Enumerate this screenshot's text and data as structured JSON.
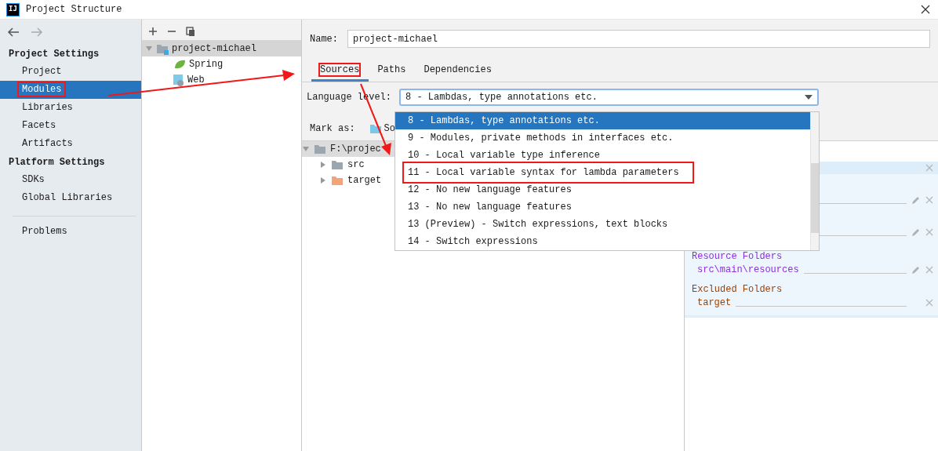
{
  "window": {
    "title": "Project Structure",
    "logo": "IJ"
  },
  "nav": {
    "sections": [
      {
        "heading": "Project Settings",
        "items": [
          {
            "label": "Project",
            "selected": false,
            "highlighted": false
          },
          {
            "label": "Modules",
            "selected": true,
            "highlighted": true
          },
          {
            "label": "Libraries",
            "selected": false,
            "highlighted": false
          },
          {
            "label": "Facets",
            "selected": false,
            "highlighted": false
          },
          {
            "label": "Artifacts",
            "selected": false,
            "highlighted": false
          }
        ]
      },
      {
        "heading": "Platform Settings",
        "items": [
          {
            "label": "SDKs",
            "selected": false,
            "highlighted": false
          },
          {
            "label": "Global Libraries",
            "selected": false,
            "highlighted": false
          }
        ]
      }
    ],
    "extra_items": [
      {
        "label": "Problems",
        "selected": false,
        "highlighted": false
      }
    ]
  },
  "module_tree": {
    "items": [
      {
        "label": "project-michael",
        "kind": "module",
        "selected": true,
        "expanded": true,
        "children": [
          {
            "label": "Spring",
            "kind": "spring",
            "selected": false
          },
          {
            "label": "Web",
            "kind": "web",
            "selected": false
          }
        ]
      }
    ]
  },
  "editor": {
    "name_label": "Name:",
    "name_value": "project-michael",
    "tabs": [
      {
        "label": "Sources",
        "selected": true,
        "highlighted": true
      },
      {
        "label": "Paths",
        "selected": false,
        "highlighted": false
      },
      {
        "label": "Dependencies",
        "selected": false,
        "highlighted": false
      }
    ],
    "language_level": {
      "label": "Language level:",
      "value": "8 - Lambdas, type annotations etc."
    },
    "mark_as": {
      "label": "Mark as:",
      "buttons": [
        "So"
      ]
    },
    "content_tree": [
      {
        "label": "F:\\projec",
        "kind": "root",
        "expanded": true,
        "children": [
          {
            "label": "src",
            "kind": "plain",
            "expanded": false
          },
          {
            "label": "target",
            "kind": "excluded",
            "expanded": false
          }
        ]
      }
    ],
    "roots_panel": {
      "groups": [
        {
          "heading": "Resource Folders",
          "kind": "resource",
          "paths": [
            {
              "path": "src\\main\\resources",
              "editable": true
            }
          ]
        },
        {
          "heading": "Excluded Folders",
          "kind": "excluded",
          "paths": [
            {
              "path": "target",
              "editable": false
            }
          ]
        }
      ]
    }
  },
  "popup": {
    "options": [
      {
        "label": "8 - Lambdas, type annotations etc.",
        "selected": true,
        "highlighted": false
      },
      {
        "label": "9 - Modules, private methods in interfaces etc.",
        "selected": false,
        "highlighted": false
      },
      {
        "label": "10 - Local variable type inference",
        "selected": false,
        "highlighted": false
      },
      {
        "label": "11 - Local variable syntax for lambda parameters",
        "selected": false,
        "highlighted": true
      },
      {
        "label": "12 - No new language features",
        "selected": false,
        "highlighted": false
      },
      {
        "label": "13 - No new language features",
        "selected": false,
        "highlighted": false
      },
      {
        "label": "13 (Preview) - Switch expressions, text blocks",
        "selected": false,
        "highlighted": false
      },
      {
        "label": "14 - Switch expressions",
        "selected": false,
        "highlighted": false
      }
    ]
  }
}
